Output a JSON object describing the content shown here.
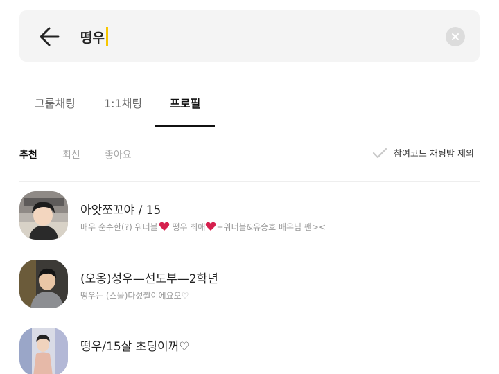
{
  "search": {
    "query": "떵우"
  },
  "tabs": [
    {
      "label": "그룹채팅",
      "active": false
    },
    {
      "label": "1:1채팅",
      "active": false
    },
    {
      "label": "프로필",
      "active": true
    }
  ],
  "sort": [
    {
      "label": "추천",
      "active": true
    },
    {
      "label": "최신",
      "active": false
    },
    {
      "label": "좋아요",
      "active": false
    }
  ],
  "filter": {
    "exclude_label": "참여코드 채팅방 제외",
    "icon": "check-icon"
  },
  "colors": {
    "accent": "#f7c600",
    "heart": "#d6204e"
  },
  "profiles": [
    {
      "name": "아앗쪼꼬야 / 15",
      "desc_part1": "매우 순수한(?) 워너블",
      "desc_part2": " 떵우 최애",
      "desc_part3": "+워너블&유승호 배우님 팬><"
    },
    {
      "name": "(오옹)성우—선도부—2학년",
      "desc": "떵우는 (스물)다섰짤이에요오♡"
    },
    {
      "name": "떵우/15살 초딩이꺼♡"
    }
  ]
}
